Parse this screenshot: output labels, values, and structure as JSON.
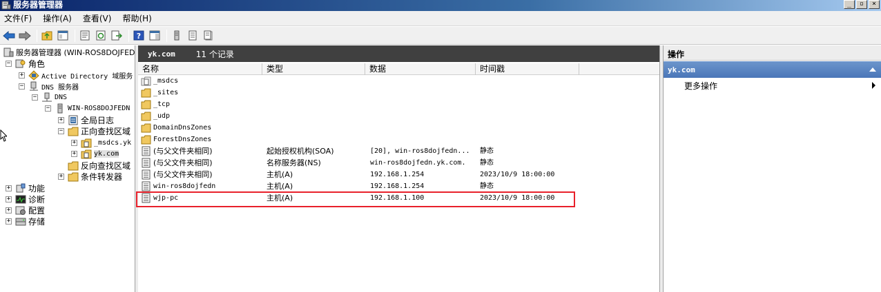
{
  "window": {
    "title": "服务器管理器",
    "btn_min": "_",
    "btn_restore": "▫",
    "btn_close": "×"
  },
  "menu": [
    "文件(F)",
    "操作(A)",
    "查看(V)",
    "帮助(H)"
  ],
  "tree": {
    "root": "服务器管理器 (WIN-ROS8DOJFED",
    "roles": "角色",
    "ad": "Active Directory 域服务",
    "dns_server": "DNS 服务器",
    "dns": "DNS",
    "host": "WIN-ROS8DOJFEDN",
    "global_log": "全局日志",
    "forward_zones": "正向查找区域",
    "msdcs_zone": "_msdcs.yk",
    "yk_zone": "yk.com",
    "reverse_zones": "反向查找区域",
    "forwarders": "条件转发器",
    "features": "功能",
    "diagnostics": "诊断",
    "configuration": "配置",
    "storage": "存储"
  },
  "middle": {
    "zone": "yk.com",
    "count": "11 个记录",
    "columns": [
      "名称",
      "类型",
      "数据",
      "时间戳"
    ],
    "rows": [
      {
        "name": "_msdcs",
        "type": "",
        "data": "",
        "time": "",
        "icon": "folder-doc-icon"
      },
      {
        "name": "_sites",
        "type": "",
        "data": "",
        "time": "",
        "icon": "folder-icon"
      },
      {
        "name": "_tcp",
        "type": "",
        "data": "",
        "time": "",
        "icon": "folder-icon"
      },
      {
        "name": "_udp",
        "type": "",
        "data": "",
        "time": "",
        "icon": "folder-icon"
      },
      {
        "name": "DomainDnsZones",
        "type": "",
        "data": "",
        "time": "",
        "icon": "folder-icon"
      },
      {
        "name": "ForestDnsZones",
        "type": "",
        "data": "",
        "time": "",
        "icon": "folder-icon"
      },
      {
        "name": "(与父文件夹相同)",
        "type": "起始授权机构(SOA)",
        "data": "[20], win-ros8dojfedn...",
        "time": "静态",
        "icon": "record-icon"
      },
      {
        "name": "(与父文件夹相同)",
        "type": "名称服务器(NS)",
        "data": "win-ros8dojfedn.yk.com.",
        "time": "静态",
        "icon": "record-icon"
      },
      {
        "name": "(与父文件夹相同)",
        "type": "主机(A)",
        "data": "192.168.1.254",
        "time": "2023/10/9 18:00:00",
        "icon": "record-icon"
      },
      {
        "name": "win-ros8dojfedn",
        "type": "主机(A)",
        "data": "192.168.1.254",
        "time": "静态",
        "icon": "record-icon"
      },
      {
        "name": "wjp-pc",
        "type": "主机(A)",
        "data": "192.168.1.100",
        "time": "2023/10/9 18:00:00",
        "icon": "record-icon"
      }
    ]
  },
  "actions": {
    "title": "操作",
    "section": "yk.com",
    "more": "更多操作"
  },
  "colors": {
    "highlight": "#e8202a",
    "header_dark": "#404040",
    "section_blue": "#4a76b8"
  }
}
